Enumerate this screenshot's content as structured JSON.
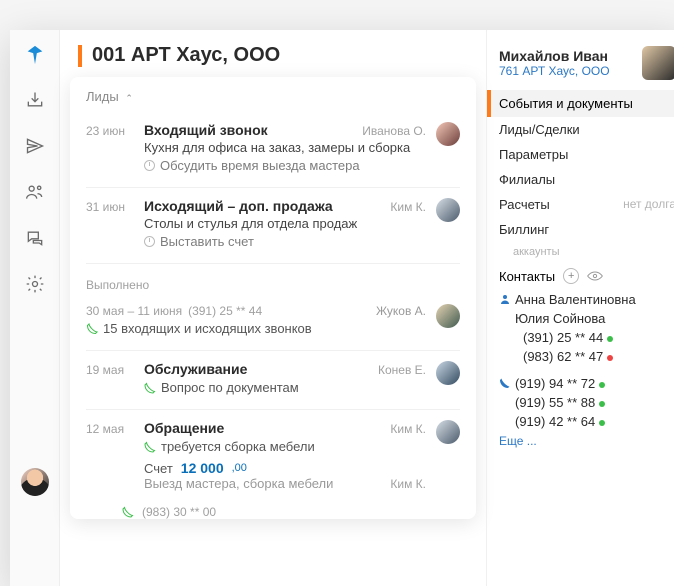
{
  "title": "001 АРТ Хаус, ООО",
  "filter": {
    "label": "Лиды"
  },
  "events": [
    {
      "date": "23 июн",
      "headline": "Входящий звонок",
      "assignee": "Иванова О.",
      "desc": "Кухня для офиса на заказ, замеры и сборка",
      "task": "Обсудить время выезда мастера",
      "avatar": "av1"
    },
    {
      "date": "31 июн",
      "headline": "Исходящий – доп. продажа",
      "assignee": "Ким К.",
      "desc": "Столы и стулья для отдела продаж",
      "task": "Выставить счет",
      "avatar": "av2"
    }
  ],
  "done_label": "Выполнено",
  "done_range": {
    "range": "30 мая – 11 июня",
    "phone": "(391) 25 ** 44",
    "assignee": "Жуков А.",
    "summary": "15 входящих и исходящих звонков",
    "avatar": "av3"
  },
  "done_events": [
    {
      "date": "19 мая",
      "headline": "Обслуживание",
      "assignee": "Конев Е.",
      "desc": "Вопрос по документам",
      "avatar": "av4"
    },
    {
      "date": "12 мая",
      "headline": "Обращение",
      "assignee": "Ким К.",
      "desc": "требуется сборка мебели",
      "avatar": "av2",
      "bill": {
        "label": "Счет",
        "amount": "12 000",
        "cents": ",00",
        "note": "Выезд мастера, сборка мебели",
        "assignee2": "Ким К."
      }
    }
  ],
  "bottom": {
    "phone": "(983) 30 ** 00"
  },
  "right": {
    "person": {
      "name": "Михайлов Иван",
      "sub": "761 АРТ Хаус, ООО"
    },
    "active_section": "События и документы",
    "links": [
      {
        "label": "Лиды/Сделки"
      },
      {
        "label": "Параметры"
      },
      {
        "label": "Филиалы"
      },
      {
        "label": "Расчеты",
        "hint": "нет долга"
      },
      {
        "label": "Биллинг"
      }
    ],
    "accounts_label": "аккаунты",
    "contacts_label": "Контакты",
    "contacts": [
      {
        "name": "Анна Валентиновна",
        "icon": "person"
      },
      {
        "name": "Юлия Сойнова"
      }
    ],
    "phones1": [
      {
        "num": "(391) 25 ** 44",
        "status": "green"
      },
      {
        "num": "(983) 62 ** 47",
        "status": "red"
      }
    ],
    "phones2": [
      {
        "num": "(919) 94 ** 72",
        "status": "green",
        "icon": "phone"
      },
      {
        "num": "(919) 55 ** 88",
        "status": "green"
      },
      {
        "num": "(919) 42 ** 64",
        "status": "green"
      }
    ],
    "more": "Еще ..."
  }
}
